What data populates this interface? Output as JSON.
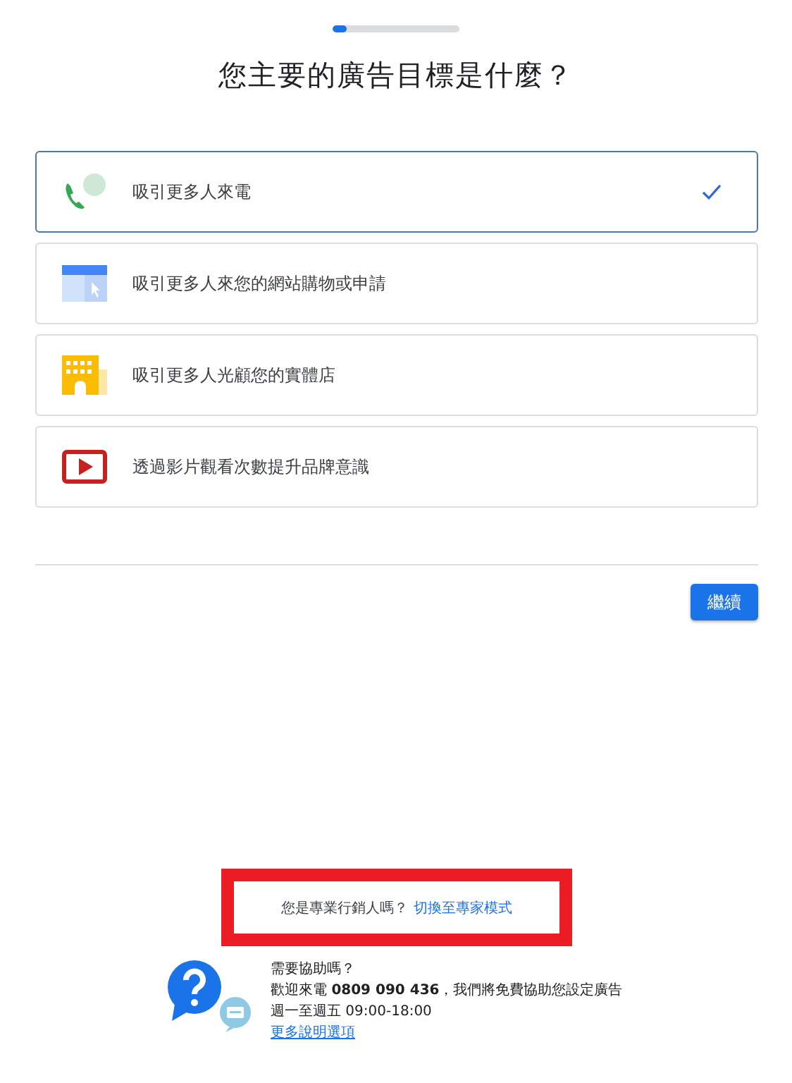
{
  "progress": {
    "level": 0.11
  },
  "title": "您主要的廣告目標是什麼？",
  "options": [
    {
      "kind": "calls",
      "label": "吸引更多人來電",
      "selected": true
    },
    {
      "kind": "website",
      "label": "吸引更多人來您的網站購物或申請",
      "selected": false
    },
    {
      "kind": "store",
      "label": "吸引更多人光顧您的實體店",
      "selected": false
    },
    {
      "kind": "video",
      "label": "透過影片觀看次數提升品牌意識",
      "selected": false
    }
  ],
  "continue_button": "繼續",
  "expert_prompt": {
    "question": "您是專業行銷人嗎？",
    "link": "切換至專家模式"
  },
  "help": {
    "heading": "需要協助嗎？",
    "call_text": "歡迎來電 **0809 090 436**，我們將免費協助您設定廣告",
    "hours": "週一至週五 09:00-18:00",
    "more_link": "更多說明選項"
  }
}
